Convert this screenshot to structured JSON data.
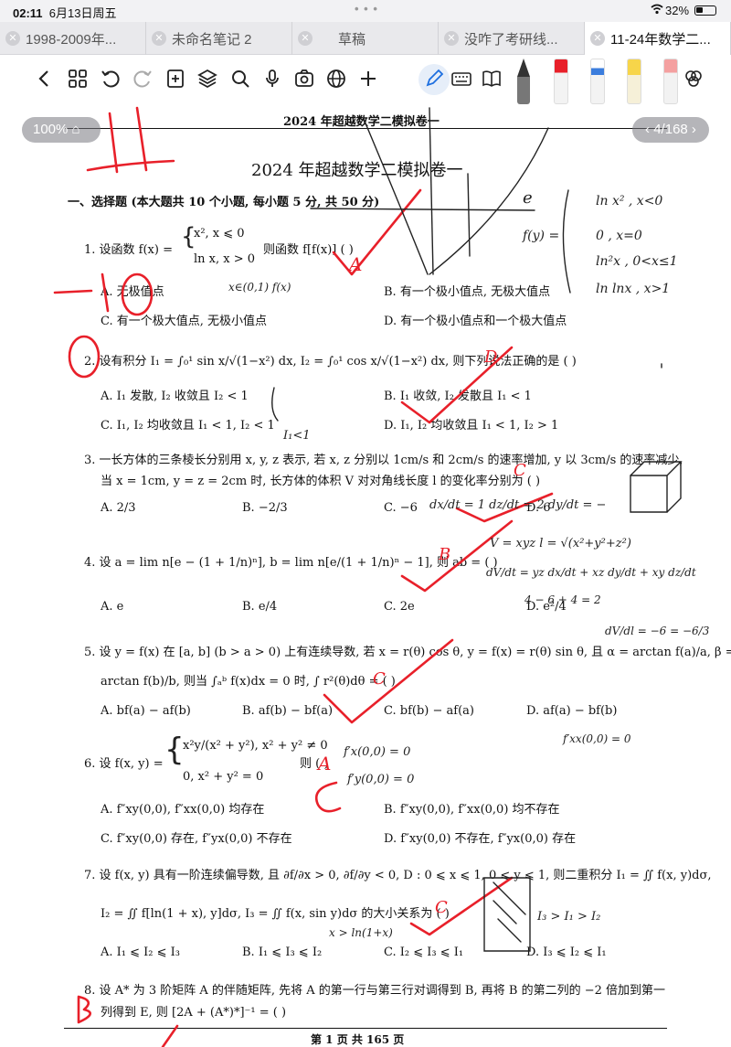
{
  "status_bar": {
    "time": "02:11",
    "date": "6月13日周五",
    "battery": "32%"
  },
  "tabs": [
    {
      "label": "1998-2009年..."
    },
    {
      "label": "未命名笔记 2"
    },
    {
      "label": "草稿"
    },
    {
      "label": "没咋了考研线..."
    },
    {
      "label": "11-24年数学二..."
    }
  ],
  "toolbar_icons": [
    "back-icon",
    "grid-icon",
    "undo-icon",
    "redo-icon",
    "add-page-icon",
    "layers-icon",
    "search-icon",
    "mic-icon",
    "media-icon",
    "globe-icon",
    "plus-icon",
    "pen-icon",
    "keyboard-icon",
    "book-icon",
    "fountain-pen-icon",
    "marker-red-icon",
    "pencil-blue-icon",
    "highlighter-yellow-icon",
    "eraser-icon",
    "color-picker-icon"
  ],
  "zoom": "100%",
  "page_indicator": "4/168",
  "document": {
    "running_head": "2024 年超越数学二模拟卷一",
    "title": "2024 年超越数学二模拟卷一",
    "section": "一、选择题 (本大题共 10 个小题, 每小题 5 分, 共 50 分)",
    "q1": {
      "stem_a": "1.  设函数 f(x) =",
      "case1": "x², x ⩽ 0",
      "case2": "ln x,  x > 0",
      "stem_b": "则函数 f[f(x)] (    )",
      "A": "A. 无极值点",
      "B": "B. 有一个极小值点, 无极大值点",
      "C": "C. 有一个极大值点, 无极小值点",
      "D": "D. 有一个极小值点和一个极大值点"
    },
    "q2": {
      "stem": "2.  设有积分 I₁ = ∫₀¹ sin x/√(1−x²) dx, I₂ = ∫₀¹ cos x/√(1−x²) dx, 则下列说法正确的是 (    )",
      "A": "A. I₁ 发散, I₂ 收敛且 I₂ < 1",
      "B": "B. I₁ 收敛, I₂ 发散且 I₁ < 1",
      "C": "C. I₁, I₂ 均收敛且 I₁ < 1, I₂ < 1",
      "D": "D. I₁, I₂ 均收敛且 I₁ < 1, I₂ > 1"
    },
    "q3": {
      "stem1": "3.  一长方体的三条棱长分别用 x, y, z 表示, 若 x, z 分别以 1cm/s 和 2cm/s 的速率增加, y 以 3cm/s 的速率减少,",
      "stem2": "当 x = 1cm, y = z = 2cm 时, 长方体的体积 V 对对角线长度 l 的变化率分别为 (    )",
      "A": "A. 2/3",
      "B": "B. −2/3",
      "C": "C. −6",
      "D": "D. 6"
    },
    "q4": {
      "stem": "4.  设 a = lim n[e − (1 + 1/n)ⁿ], b = lim n[e/(1 + 1/n)ⁿ − 1], 则 ab = (    )",
      "A": "A. e",
      "B": "B. e/4",
      "C": "C. 2e",
      "D": "D. e²/4"
    },
    "q5": {
      "stem1": "5.  设 y = f(x) 在 [a, b] (b > a > 0) 上有连续导数, 若 x = r(θ) cos θ, y = f(x) = r(θ) sin θ, 且 α = arctan f(a)/a, β =",
      "stem2": "arctan f(b)/b, 则当 ∫ₐᵇ f(x)dx = 0 时, ∫ r²(θ)dθ = (    )",
      "A": "A. bf(a) − af(b)",
      "B": "B. af(b) − bf(a)",
      "C": "C. bf(b) − af(a)",
      "D": "D. af(a) − bf(b)"
    },
    "q6": {
      "stem_a": "6.  设 f(x, y) =",
      "case1": "x²y/(x² + y²),  x² + y² ≠ 0",
      "case2": "0,  x² + y² = 0",
      "stem_b": "则 (    )",
      "A": "A. f″xy(0,0), f″xx(0,0) 均存在",
      "B": "B. f″xy(0,0), f″xx(0,0) 均不存在",
      "C": "C. f″xy(0,0) 存在, f″yx(0,0) 不存在",
      "D": "D. f″xy(0,0) 不存在, f″yx(0,0) 存在"
    },
    "q7": {
      "stem1": "7.  设 f(x, y) 具有一阶连续偏导数, 且 ∂f/∂x > 0, ∂f/∂y < 0, D : 0 ⩽ x ⩽ 1, 0 ⩽ y ⩽ 1, 则二重积分 I₁ = ∬ f(x, y)dσ,",
      "stem2": "I₂ = ∬ f[ln(1 + x), y]dσ, I₃ = ∬ f(x, sin y)dσ 的大小关系为 (    )",
      "A": "A. I₁ ⩽ I₂ ⩽ I₃",
      "B": "B. I₁ ⩽ I₃ ⩽ I₂",
      "C": "C. I₂ ⩽ I₃ ⩽ I₁",
      "D": "D. I₃ ⩽ I₂ ⩽ I₁"
    },
    "q8": {
      "stem1": "8.  设 A* 为 3 阶矩阵 A 的伴随矩阵, 先将 A 的第一行与第三行对调得到 B, 再将 B 的第二列的 −2 倍加到第一",
      "stem2": "列得到 E, 则 [2A + (A*)*]⁻¹ = (    )"
    },
    "footer": "第 1 页    共 165 页"
  },
  "handwriting": {
    "answers": {
      "q1": "A",
      "q2": "D",
      "q3": "C",
      "q4": "B",
      "q5": "C",
      "q6": "A",
      "q7": "C"
    },
    "scores": {
      "top": "11",
      "minus": "−10",
      "q2_mark": "0",
      "q8_mark": "B"
    },
    "notes": [
      "x∈(0,1) f(x)",
      "f(y) =",
      "ln x²   , x<0",
      "0       , x=0",
      "ln²x    , 0<x≤1",
      "ln lnx  , x>1",
      "I₁<1",
      "dx/dt = 1  dz/dt = 2  dy/dt = −",
      "V = xyz   l = √(x²+y²+z²)",
      "dV/dt = yz dx/dt + xz dy/dt + xy dz/dt",
      "4 − 6 + 4 = 2",
      "dV/dl = −6 = −6/3",
      "f′x(0,0) = 0",
      "f′y(0,0) = 0",
      "f′xx(0,0) = 0",
      "I₃ > I₁ > I₂",
      "x > ln(1+x)",
      "e"
    ]
  },
  "colors": {
    "ink_red": "#e8202a",
    "toolbar_accent": "#1d6fe0",
    "tab_active": "#ffffff"
  }
}
